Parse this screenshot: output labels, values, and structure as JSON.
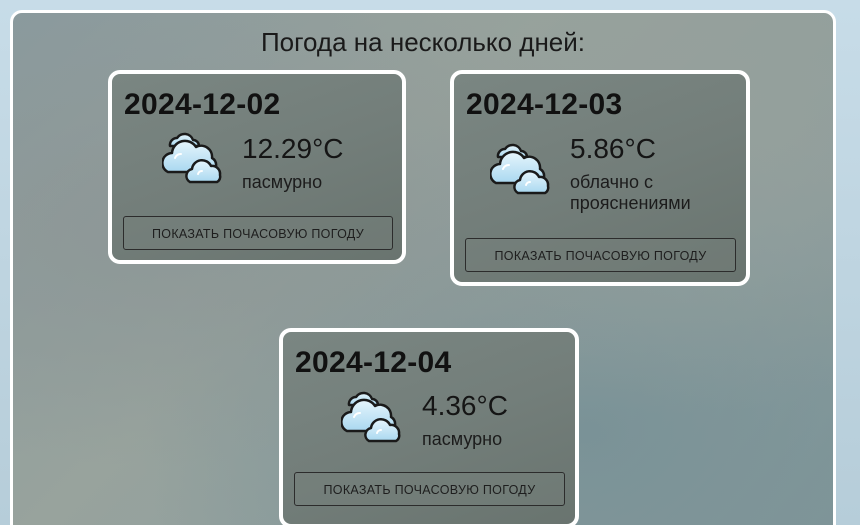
{
  "title": "Погода на несколько дней:",
  "forecast": [
    {
      "date": "2024-12-02",
      "temp": "12.29°C",
      "desc": "пасмурно",
      "icon": "clouds-icon",
      "button": "ПОКАЗАТЬ ПОЧАСОВУЮ ПОГОДУ"
    },
    {
      "date": "2024-12-03",
      "temp": "5.86°C",
      "desc": "облачно с прояснениями",
      "icon": "clouds-icon",
      "button": "ПОКАЗАТЬ ПОЧАСОВУЮ ПОГОДУ"
    },
    {
      "date": "2024-12-04",
      "temp": "4.36°C",
      "desc": "пасмурно",
      "icon": "clouds-icon",
      "button": "ПОКАЗАТЬ ПОЧАСОВУЮ ПОГОДУ"
    }
  ]
}
